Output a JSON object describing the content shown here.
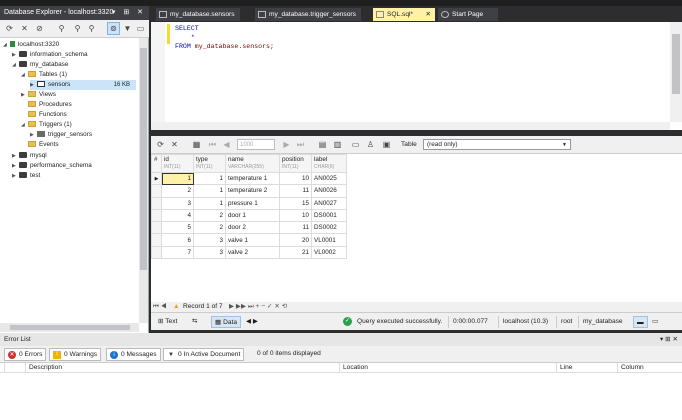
{
  "explorer": {
    "title": "Database Explorer - localhost:3320",
    "window_buttons": "▾ ⊞ ✕",
    "tree": {
      "server": "localhost:3320",
      "information_schema": "information_schema",
      "my_database": "my_database",
      "tables": "Tables (1)",
      "sensors": "sensors",
      "sensors_size": "16 KB",
      "views": "Views",
      "procedures": "Procedures",
      "functions": "Functions",
      "triggers": "Triggers (1)",
      "trigger_sensors": "trigger_sensors",
      "events": "Events",
      "mysql": "mysql",
      "performance_schema": "performance_schema",
      "test": "test"
    }
  },
  "tabs": [
    {
      "label": "my_database.sensors"
    },
    {
      "label": "my_database.trigger_sensors"
    },
    {
      "label": "SQL.sql*",
      "close": "✕"
    },
    {
      "label": "Start Page"
    }
  ],
  "editor": {
    "line1": "SELECT",
    "line2": "    *",
    "line3_kw": "FROM ",
    "line3_ref": "my_database.sensors;"
  },
  "grid_toolbar": {
    "limit_value": "1000",
    "table_label": "Table",
    "table_mode": "(read only)"
  },
  "grid": {
    "columns": [
      {
        "name": "id",
        "type": "INT(11)"
      },
      {
        "name": "type",
        "type": "INT(11)"
      },
      {
        "name": "name",
        "type": "VARCHAR(255)"
      },
      {
        "name": "position",
        "type": "INT(11)"
      },
      {
        "name": "label",
        "type": "CHAR(6)"
      }
    ],
    "rows": [
      [
        "1",
        "1",
        "temperature 1",
        "10",
        "AN0025"
      ],
      [
        "2",
        "1",
        "temperature 2",
        "11",
        "AN0026"
      ],
      [
        "3",
        "1",
        "pressure 1",
        "15",
        "AN0027"
      ],
      [
        "4",
        "2",
        "door 1",
        "10",
        "DS0001"
      ],
      [
        "5",
        "2",
        "door 2",
        "11",
        "DS0002"
      ],
      [
        "6",
        "3",
        "valve 1",
        "20",
        "VL0001"
      ],
      [
        "7",
        "3",
        "valve 2",
        "21",
        "VL0002"
      ]
    ]
  },
  "navigator": {
    "record_text": "Record 1 of 7",
    "nav_glyphs": "⏮ ◀ ▶ ▶▶ ⏭ + − ✓ ✕ ⟲",
    "nav_start": "⏮ ◀",
    "nav_end": "▶ ▶▶ ⏭ + − ✓ ✕ ⟲"
  },
  "status": {
    "text_tab": "Text",
    "data_tab": "Data",
    "message": "Query executed successfully.",
    "duration": "0:00:00.077",
    "server": "localhost (10.3)",
    "user": "root",
    "database": "my_database"
  },
  "error_list": {
    "title": "Error List",
    "window_buttons": "▾ ⊞ ✕",
    "errors": "0 Errors",
    "warnings": "0 Warnings",
    "messages": "0 Messages",
    "in_active_document": "0 In Active Document",
    "count": "0 of 0 items displayed",
    "columns": {
      "description": "Description",
      "location": "Location",
      "line": "Line",
      "column": "Column"
    }
  }
}
